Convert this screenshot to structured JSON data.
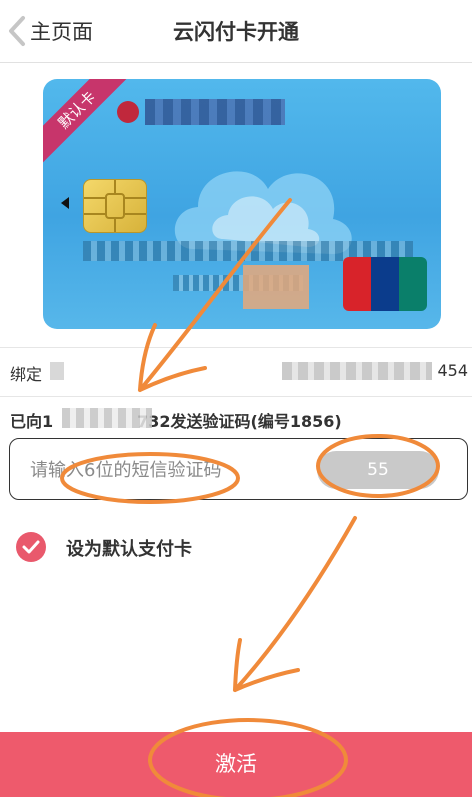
{
  "header": {
    "back_label": "主页面",
    "title": "云闪付卡开通"
  },
  "card": {
    "default_ribbon": "默认卡",
    "brand": "unionpay"
  },
  "binding": {
    "label": "绑定",
    "tail_digits": "454"
  },
  "sms": {
    "sent_prefix": "已向1",
    "sent_suffix": "732发送验证码(编号1856)",
    "input_value": "",
    "placeholder": "请输入6位的短信验证码",
    "countdown": "55"
  },
  "default_option": {
    "label": "设为默认支付卡",
    "checked": true
  },
  "actions": {
    "activate_label": "激活"
  },
  "colors": {
    "primary": "#ee5a6c",
    "checkbox": "#e9596c",
    "card": "#3fa4e2",
    "annotation": "#f08a3a"
  }
}
